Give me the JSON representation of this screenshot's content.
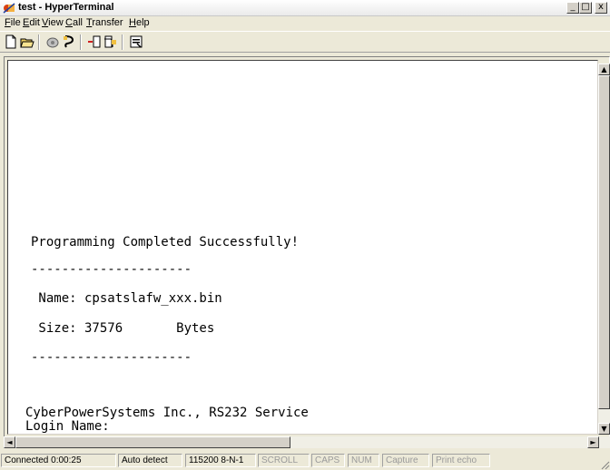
{
  "window": {
    "title": "test - HyperTerminal",
    "minimize": "_",
    "maximize": "□",
    "close": "x"
  },
  "menu": {
    "file": {
      "u": "F",
      "rest": "ile"
    },
    "edit": {
      "u": "E",
      "rest": "dit"
    },
    "view": {
      "u": "V",
      "rest": "iew"
    },
    "call": {
      "u": "C",
      "rest": "all"
    },
    "transfer": {
      "u": "T",
      "rest": "ransfer"
    },
    "help": {
      "u": "H",
      "rest": "elp"
    }
  },
  "toolbar": {
    "icons": [
      "new-icon",
      "open-icon",
      "call-icon",
      "disconnect-icon",
      "send-icon",
      "receive-icon",
      "properties-icon"
    ]
  },
  "terminal": {
    "lines": {
      "programming": "Programming Completed Successfully!",
      "sep1": "---------------------",
      "name": " Name: cpsatslafw_xxx.bin",
      "size": " Size: 37576       Bytes",
      "sep2": "---------------------",
      "company": "CyberPowerSystems Inc., RS232 Service",
      "login": "Login Name:"
    }
  },
  "scroll": {
    "up": "▲",
    "down": "▼",
    "left": "◄",
    "right": "►"
  },
  "status": {
    "connected": "Connected 0:00:25",
    "detect": "Auto detect",
    "settings": "115200 8-N-1",
    "scroll": "SCROLL",
    "caps": "CAPS",
    "num": "NUM",
    "capture": "Capture",
    "print_echo": "Print echo"
  },
  "colors": {
    "chrome": "#ece9d8",
    "terminal_bg": "#ffffff",
    "text": "#000000"
  }
}
